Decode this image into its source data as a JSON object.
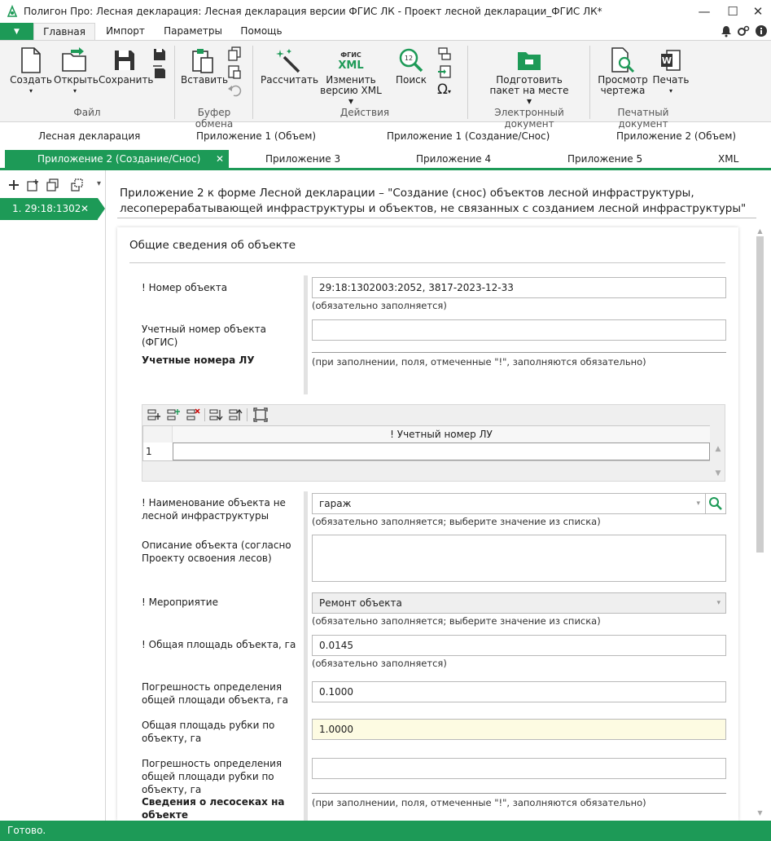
{
  "window": {
    "title": "Полигон Про: Лесная декларация: Лесная декларация версии ФГИС ЛК - Проект лесной декларации_ФГИС ЛК*",
    "minimize": "—",
    "maximize": "☐",
    "close": "✕"
  },
  "menu": {
    "drop": "▼",
    "tabs": [
      "Главная",
      "Импорт",
      "Параметры",
      "Помощь"
    ]
  },
  "ribbon": {
    "file": {
      "create": "Создать",
      "open": "Открыть",
      "save": "Сохранить",
      "group": "Файл"
    },
    "clipboard": {
      "paste": "Вставить",
      "group": "Буфер обмена"
    },
    "actions": {
      "calc": "Рассчитать",
      "fgis_top": "ФГИС",
      "fgis_bottom": "XML",
      "change_l1": "Изменить",
      "change_l2": "версию XML ▾",
      "search": "Поиск",
      "search_badge": "12",
      "omega": "Ω",
      "group": "Действия"
    },
    "edoc": {
      "l1": "Подготовить",
      "l2": "пакет на месте ▾",
      "group": "Электронный документ"
    },
    "print": {
      "view_l1": "Просмотр",
      "view_l2": "чертежа",
      "print": "Печать",
      "word_letter": "W",
      "group": "Печатный документ"
    }
  },
  "tabs_row1": [
    "Лесная декларация",
    "Приложение 1 (Объем)",
    "Приложение 1 (Создание/Снос)",
    "Приложение 2 (Объем)"
  ],
  "tabs_row2": {
    "active": "Приложение 2 (Создание/Снос)",
    "others": [
      "Приложение 3",
      "Приложение 4",
      "Приложение 5",
      "XML"
    ],
    "close": "✕"
  },
  "left_pane": {
    "item": "1.   29:18:1302",
    "close": "✕",
    "more": "▾"
  },
  "form": {
    "heading": "Приложение 2 к форме Лесной декларации – \"Создание (снос) объектов лесной инфраструктуры, лесоперерабатывающей инфраструктуры и объектов, не связанных с созданием лесной инфраструктуры\"",
    "section": "Общие сведения об объекте",
    "object_number_label": "! Номер объекта",
    "object_number_value": "29:18:1302003:2052, 3817-2023-12-33",
    "required_hint": "(обязательно заполняется)",
    "fgis_number_label": "Учетный номер объекта (ФГИС)",
    "fgis_number_value": "",
    "lu_numbers_label": "Учетные номера ЛУ",
    "lu_hint": "(при заполнении, поля, отмеченные \"!\", заполняются обязательно)",
    "grid_header": "! Учетный номер ЛУ",
    "grid_row": "1",
    "name_label": "! Наименование объекта не лесной инфраструктуры",
    "name_value": "гараж",
    "list_hint": "(обязательно заполняется; выберите значение из списка)",
    "desc_label": "Описание объекта (согласно Проекту освоения лесов)",
    "desc_value": "",
    "measure_label": "! Мероприятие",
    "measure_value": "Ремонт объекта",
    "area_label": "! Общая площадь объекта, га",
    "area_value": "0.0145",
    "area_err_label": "Погрешность определения общей площади объекта, га",
    "area_err_value": "0.1000",
    "cut_area_label": "Общая площадь рубки по объекту, га",
    "cut_area_value": "1.0000",
    "cut_err_label": "Погрешность определения общей площади рубки по объекту, га",
    "cut_err_value": "",
    "plots_label": "Сведения о лесосеках на объекте",
    "plots_hint": "(при заполнении, поля, отмеченные \"!\", заполняются обязательно)"
  },
  "status": "Готово.",
  "colors": {
    "accent": "#1d9a57",
    "highlight": "#fdfbe2"
  }
}
